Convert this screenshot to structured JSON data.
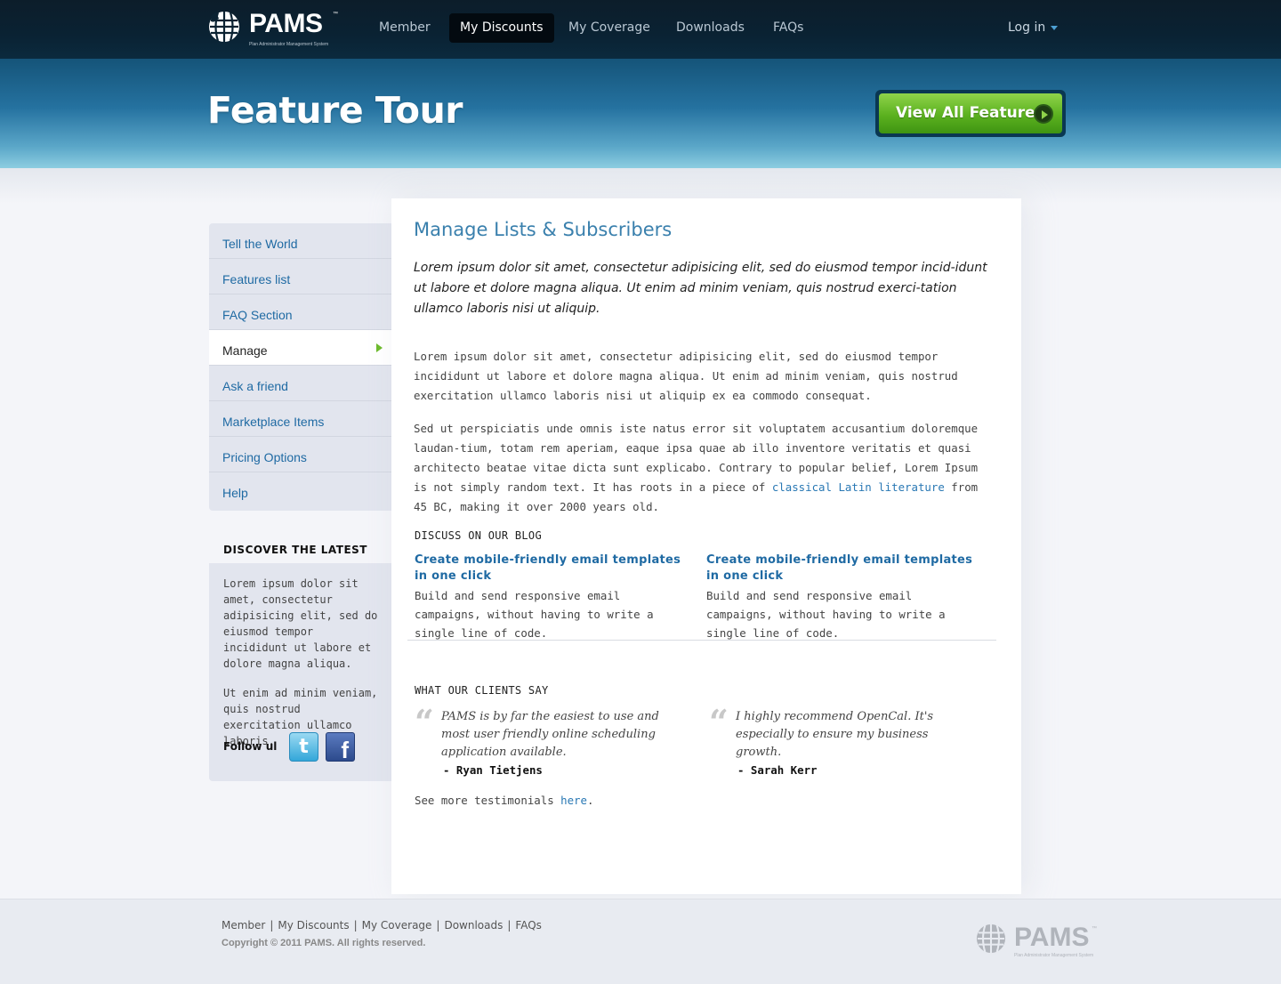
{
  "brand": {
    "name": "PAMS",
    "trademark": "™",
    "tagline": "Plan Administrator Management System"
  },
  "nav": {
    "items": [
      {
        "label": "Member"
      },
      {
        "label": "My Discounts"
      },
      {
        "label": "My Coverage"
      },
      {
        "label": "Downloads"
      },
      {
        "label": "FAQs"
      }
    ],
    "active_index": 1,
    "login_label": "Log in"
  },
  "banner": {
    "title": "Feature Tour",
    "cta_label": "View All Features"
  },
  "sidebar": {
    "items": [
      {
        "label": "Tell the World"
      },
      {
        "label": "Features list"
      },
      {
        "label": "FAQ Section"
      },
      {
        "label": "Manage"
      },
      {
        "label": "Ask a friend"
      },
      {
        "label": "Marketplace Items"
      },
      {
        "label": "Pricing Options"
      },
      {
        "label": "Help"
      }
    ],
    "active_index": 3,
    "discover_title": "DISCOVER THE LATEST",
    "discover_p1": "Lorem ipsum dolor sit amet, consectetur adipisicing elit, sed do eiusmod tempor incididunt ut labore et dolore magna aliqua.",
    "discover_p2": "Ut enim ad minim veniam, quis nostrud exercitation ullamco laboris.",
    "follow_label": "Follow ul",
    "twitter_glyph": "t",
    "facebook_glyph": "f"
  },
  "main": {
    "title": "Manage Lists & Subscribers",
    "lead": "Lorem ipsum dolor sit amet, consectetur adipisicing elit, sed do eiusmod tempor incid-idunt ut labore et dolore magna aliqua. Ut enim ad minim veniam, quis nostrud exerci-tation ullamco laboris nisi ut aliquip.",
    "p1": "Lorem ipsum dolor sit amet, consectetur adipisicing elit, sed do eiusmod tempor incididunt ut labore et dolore magna aliqua. Ut enim ad minim veniam, quis nostrud exercitation ullamco laboris nisi ut aliquip ex ea commodo consequat.",
    "p2_before": "Sed ut perspiciatis unde omnis iste natus error sit voluptatem accusantium doloremque laudan-tium, totam rem aperiam, eaque ipsa quae ab illo inventore veritatis et quasi architecto beatae vitae dicta sunt explicabo. Contrary to popular belief, Lorem Ipsum is not simply random text. It has roots in a piece of ",
    "p2_link": "classical Latin literature",
    "p2_after": " from 45 BC, making it over 2000 years old.",
    "blog_title": "DISCUSS ON OUR BLOG",
    "blog_posts": [
      {
        "title": "Create mobile-friendly email templates in one click",
        "desc": "Build and send responsive email campaigns, without having to write a single line of code."
      },
      {
        "title": "Create mobile-friendly email templates in one click",
        "desc": "Build and send responsive email campaigns, without having to write a single line of code."
      }
    ],
    "clients_title": "WHAT OUR CLIENTS SAY",
    "quote_mark": "“",
    "testimonials": [
      {
        "text": "PAMS is by far the easiest to use and  most user friendly online scheduling application available.",
        "author": "- Ryan Tietjens"
      },
      {
        "text": "I highly recommend OpenCal. It's especially to ensure my business growth.",
        "author": "- Sarah Kerr"
      }
    ],
    "more_before": "See more testimonials ",
    "more_link": "here",
    "more_after": "."
  },
  "footer": {
    "links": [
      "Member",
      "My Discounts",
      "My Coverage",
      "Downloads",
      "FAQs"
    ],
    "separator": "|",
    "copyright": "Copyright © 2011 PAMS. All rights reserved."
  }
}
